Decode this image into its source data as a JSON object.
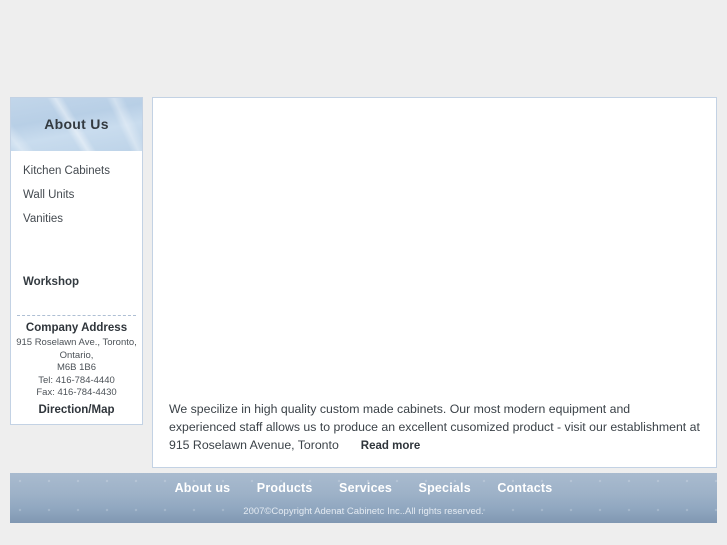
{
  "site": {
    "background_color": "#eeeeee",
    "accent_color": "#c3d2e4"
  },
  "sidebar": {
    "title": "About Us",
    "links": [
      {
        "label": "Kitchen Cabinets"
      },
      {
        "label": "Wall Units"
      },
      {
        "label": "Vanities"
      }
    ],
    "section_heading": "Workshop",
    "address": {
      "heading": "Company Address",
      "lines": [
        "915 Roselawn Ave., Toronto,",
        "Ontario,",
        "M6B 1B6",
        "Tel: 416-784-4440",
        "Fax: 416-784-4430"
      ],
      "map_link": "Direction/Map"
    }
  },
  "main": {
    "intro_text": "We specilize in high quality custom made cabinets. Our most modern equipment and experienced staff allows us to produce an excellent cusomized product - visit our establishment at 915 Roselawn Avenue, Toronto",
    "read_more": "Read more"
  },
  "footer": {
    "nav": [
      {
        "label": "About us"
      },
      {
        "label": "Products"
      },
      {
        "label": "Services"
      },
      {
        "label": "Specials"
      },
      {
        "label": "Contacts"
      }
    ],
    "copyright": "2007©Copyright Adenat Cabinetc Inc..All rights reserved."
  }
}
